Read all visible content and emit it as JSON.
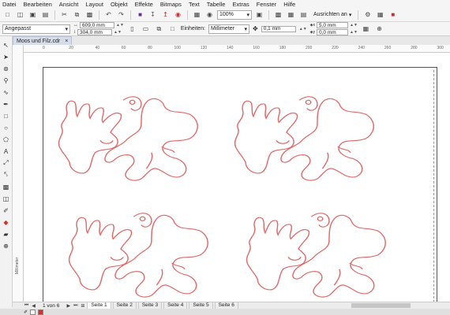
{
  "menu": [
    "Datei",
    "Bearbeiten",
    "Ansicht",
    "Layout",
    "Objekt",
    "Effekte",
    "Bitmaps",
    "Text",
    "Tabelle",
    "Extras",
    "Fenster",
    "Hilfe"
  ],
  "toolbar": {
    "zoom": "100%",
    "align_label": "Ausrichten an"
  },
  "propertybar": {
    "paper_preset": "Angepasst",
    "width": "609,0 mm",
    "height": "304,0 mm",
    "units_label": "Einheiten:",
    "units_value": "Millimeter",
    "nudge": "0,1 mm",
    "dup_x": "5,0 mm",
    "dup_y": "0,0 mm"
  },
  "document": {
    "tab_title": "Moos und Filz.cdr",
    "close_glyph": "×"
  },
  "ruler": {
    "unit_label": "Millimeter",
    "ticks": [
      "0",
      "20",
      "40",
      "60",
      "80",
      "100",
      "120",
      "140",
      "160",
      "180",
      "200",
      "220",
      "240",
      "260",
      "280",
      "300"
    ]
  },
  "pages": {
    "counter": "1 von 6",
    "tabs": [
      "Seite 1",
      "Seite 2",
      "Seite 3",
      "Seite 4",
      "Seite 5",
      "Seite 6"
    ],
    "active_index": 0
  },
  "colors": {
    "outline": "#e06a6a",
    "accent_swatch": "#d0342c"
  }
}
